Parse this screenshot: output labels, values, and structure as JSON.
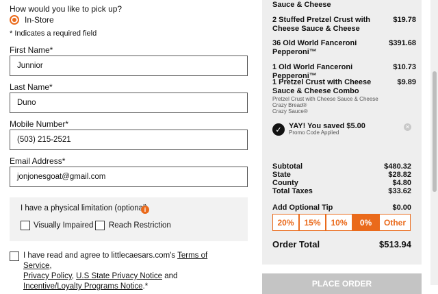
{
  "pickup": {
    "question": "How would you like to pick up?",
    "option_label": "In-Store"
  },
  "required_note": "* Indicates a required field",
  "fields": {
    "first_name": {
      "label": "First Name*",
      "value": "Junnior"
    },
    "last_name": {
      "label": "Last Name*",
      "value": "Duno"
    },
    "mobile": {
      "label": "Mobile Number*",
      "value": "(503) 215-2521"
    },
    "email": {
      "label": "Email Address*",
      "value": "jonjonesgoat@gmail.com"
    }
  },
  "limitation": {
    "title": "I have a physical limitation (optional)",
    "info_icon": "i",
    "options": [
      "Visually Impaired",
      "Reach Restriction"
    ]
  },
  "agreement": {
    "prefix": "I have read and agree to littlecaesars.com's ",
    "tos": "Terms of Service",
    "comma": ",",
    "privacy": "Privacy Policy",
    "comma2": ", ",
    "state_privacy": "U.S State Privacy Notice",
    "and": " and ",
    "loyalty": "Incentive/Loyalty Programs Notice",
    "suffix": ".*"
  },
  "order": {
    "items": [
      {
        "name": "Sauce & Cheese",
        "price": "",
        "sub": []
      },
      {
        "name": "2 Stuffed Pretzel Crust with Cheese Sauce & Cheese",
        "price": "$19.78",
        "sub": []
      },
      {
        "name": "36 Old World Fanceroni Pepperoni™",
        "price": "$391.68",
        "sub": []
      },
      {
        "name": "1 Old World Fanceroni Pepperoni™",
        "price": "$10.73",
        "sub": []
      },
      {
        "name": "1 Pretzel Crust with Cheese Sauce & Cheese Combo",
        "price": "$9.89",
        "sub": [
          "Pretzel Crust with Cheese Sauce & Cheese",
          "Crazy Bread®",
          "Crazy Sauce®"
        ]
      }
    ],
    "promo": {
      "title": "YAY! You saved $5.00",
      "subtitle": "Promo Code Applied"
    },
    "summary": [
      {
        "label": "Subtotal",
        "value": "$480.32"
      },
      {
        "label": "State",
        "value": "$28.82"
      },
      {
        "label": "County",
        "value": "$4.80"
      },
      {
        "label": "Total Taxes",
        "value": "$33.62"
      }
    ],
    "tip": {
      "label": "Add Optional Tip",
      "value": "$0.00",
      "options": [
        "20%",
        "15%",
        "10%",
        "0%",
        "Other"
      ],
      "selected": "0%"
    },
    "total": {
      "label": "Order Total",
      "value": "$513.94"
    },
    "place_order": "PLACE ORDER"
  },
  "colors": {
    "accent": "#ea6a1b",
    "panel": "#eeeeee",
    "disabled": "#c4c4c4"
  }
}
